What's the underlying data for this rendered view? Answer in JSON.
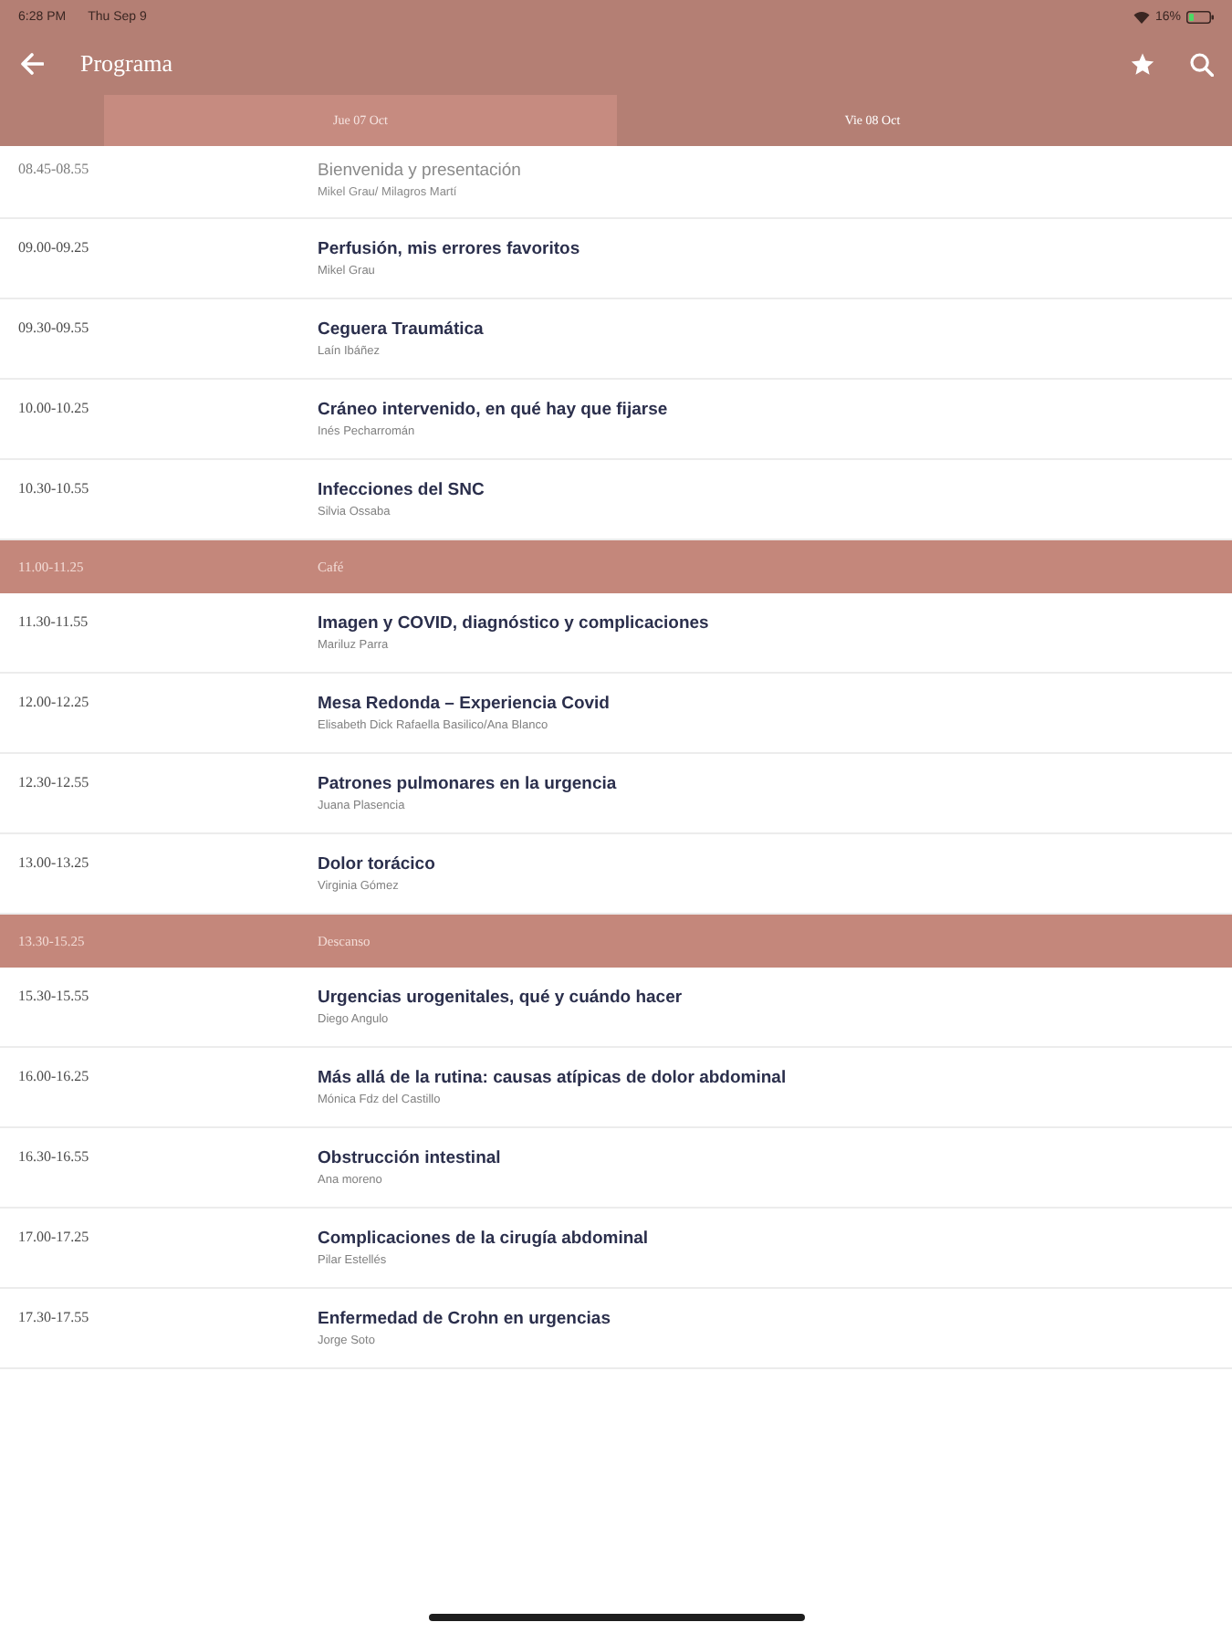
{
  "status_bar": {
    "time": "6:28 PM",
    "date": "Thu Sep 9",
    "battery": "16%"
  },
  "header": {
    "title": "Programa"
  },
  "tabs": [
    {
      "label": "Jue 07 Oct",
      "selected": true
    },
    {
      "label": "Vie 08 Oct",
      "selected": false
    }
  ],
  "schedule": [
    {
      "kind": "muted",
      "time": "08.45-08.55",
      "title": "Bienvenida y presentación",
      "speaker": "Mikel Grau/ Milagros Martí"
    },
    {
      "kind": "talk",
      "time": "09.00-09.25",
      "title": "Perfusión, mis errores favoritos",
      "speaker": "Mikel Grau"
    },
    {
      "kind": "talk",
      "time": "09.30-09.55",
      "title": "Ceguera Traumática",
      "speaker": "Laín Ibáñez"
    },
    {
      "kind": "talk",
      "time": "10.00-10.25",
      "title": "Cráneo intervenido, en qué hay que fijarse",
      "speaker": "Inés Pecharromán"
    },
    {
      "kind": "talk",
      "time": "10.30-10.55",
      "title": "Infecciones del SNC",
      "speaker": "Silvia Ossaba"
    },
    {
      "kind": "break",
      "time": "11.00-11.25",
      "title": "Café"
    },
    {
      "kind": "talk",
      "time": "11.30-11.55",
      "title": "Imagen y COVID, diagnóstico y complicaciones",
      "speaker": "Mariluz Parra"
    },
    {
      "kind": "talk",
      "time": "12.00-12.25",
      "title": "Mesa Redonda – Experiencia Covid",
      "speaker": "Elisabeth Dick Rafaella Basilico/Ana Blanco"
    },
    {
      "kind": "talk",
      "time": "12.30-12.55",
      "title": "Patrones pulmonares en la urgencia",
      "speaker": "Juana Plasencia"
    },
    {
      "kind": "talk",
      "time": "13.00-13.25",
      "title": "Dolor torácico",
      "speaker": "Virginia Gómez"
    },
    {
      "kind": "break",
      "time": "13.30-15.25",
      "title": "Descanso"
    },
    {
      "kind": "talk",
      "time": "15.30-15.55",
      "title": "Urgencias urogenitales, qué y cuándo hacer",
      "speaker": "Diego Angulo"
    },
    {
      "kind": "talk",
      "time": "16.00-16.25",
      "title": "Más allá de la rutina: causas atípicas de dolor abdominal",
      "speaker": "Mónica Fdz del Castillo"
    },
    {
      "kind": "talk",
      "time": "16.30-16.55",
      "title": "Obstrucción intestinal",
      "speaker": "Ana moreno"
    },
    {
      "kind": "talk",
      "time": "17.00-17.25",
      "title": "Complicaciones de la cirugía abdominal",
      "speaker": "Pilar Estellés"
    },
    {
      "kind": "talk",
      "time": "17.30-17.55",
      "title": "Enfermedad de Crohn en urgencias",
      "speaker": "Jorge Soto"
    }
  ]
}
